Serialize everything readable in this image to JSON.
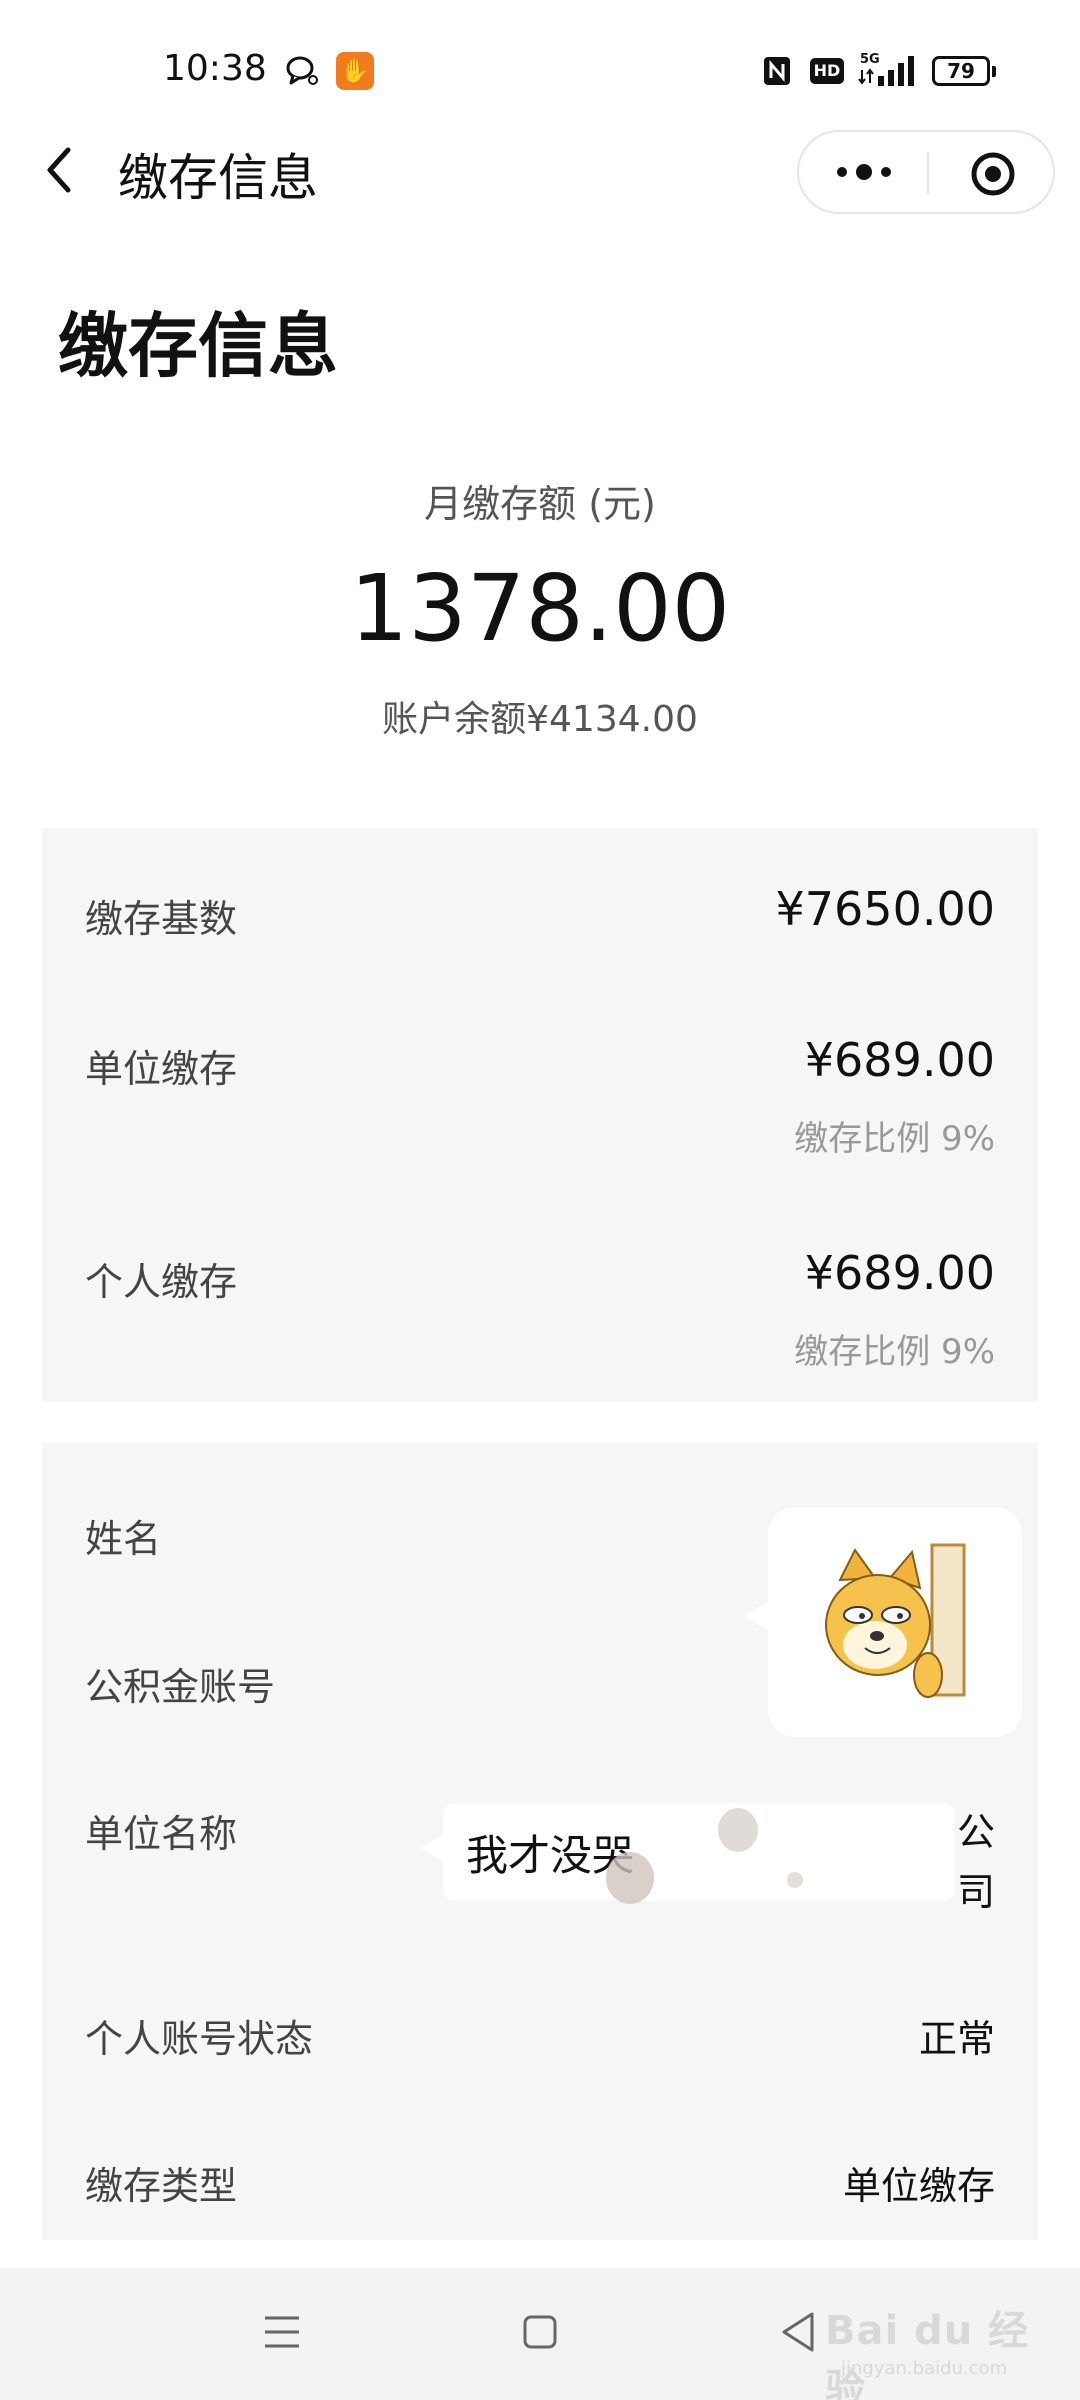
{
  "status_bar": {
    "time": "10:38",
    "battery": "79",
    "icons": [
      "chat-icon",
      "app-notification-icon",
      "nfc-icon",
      "hd-icon",
      "5g-signal-icon",
      "battery-icon"
    ]
  },
  "nav": {
    "title": "缴存信息",
    "back_icon": "chevron-left-icon",
    "more_icon": "more-dots-icon",
    "close_icon": "target-close-icon"
  },
  "page": {
    "title": "缴存信息"
  },
  "summary": {
    "label": "月缴存额 (元)",
    "amount": "1378.00",
    "balance": "账户余额¥4134.00"
  },
  "contribution": {
    "base_label": "缴存基数",
    "base_value": "¥7650.00",
    "employer_label": "单位缴存",
    "employer_value": "¥689.00",
    "employer_ratio": "缴存比例 9%",
    "personal_label": "个人缴存",
    "personal_value": "¥689.00",
    "personal_ratio": "缴存比例 9%"
  },
  "account": {
    "name_label": "姓名",
    "fund_account_label": "公积金账号",
    "employer_name_label": "单位名称",
    "employer_name_visible": [
      "公",
      "司"
    ],
    "status_label": "个人账号状态",
    "status_value": "正常",
    "type_label": "缴存类型",
    "type_value": "单位缴存"
  },
  "overlay": {
    "sticker_icon": "peeking-dog-sticker-icon",
    "bubble_text": "我才没哭"
  },
  "system_nav": {
    "menu_icon": "menu-lines-icon",
    "home_icon": "square-home-icon",
    "back_icon": "triangle-back-icon"
  },
  "watermark": {
    "text": "Bai du 经验",
    "sub": "jingyan.baidu.com"
  },
  "colors": {
    "card_bg": "#f6f6f6",
    "secondary_text": "#999999",
    "accent_orange": "#f27b20"
  }
}
